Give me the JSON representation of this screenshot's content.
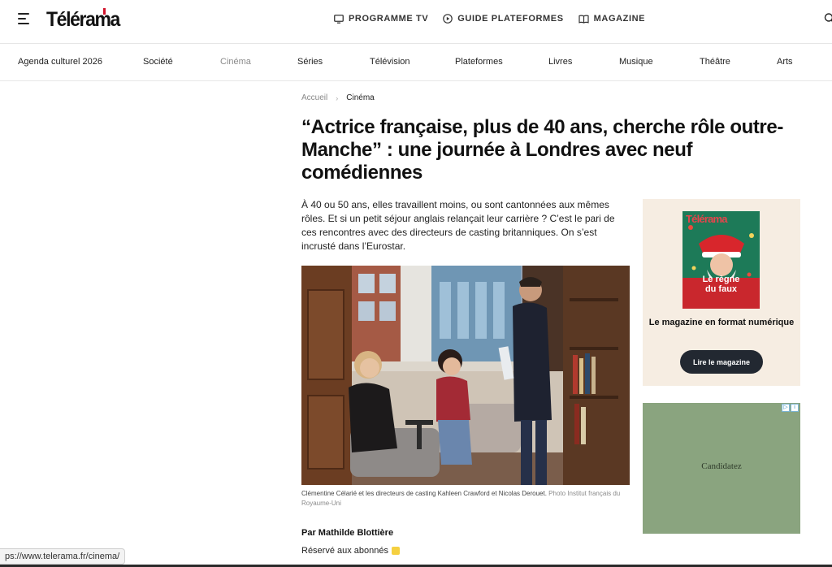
{
  "header": {
    "logo": "Télérama",
    "nav": [
      {
        "label": "PROGRAMME TV",
        "icon": "tv-icon"
      },
      {
        "label": "GUIDE PLATEFORMES",
        "icon": "play-icon"
      },
      {
        "label": "MAGAZINE",
        "icon": "book-icon"
      }
    ],
    "search_icon": "search-icon",
    "menu_icon": "hamburger-icon"
  },
  "sections": [
    "Agenda culturel 2026",
    "Société",
    "Cinéma",
    "Séries",
    "Télévision",
    "Plateformes",
    "Livres",
    "Musique",
    "Théâtre",
    "Arts"
  ],
  "active_section": "Cinéma",
  "breadcrumb": {
    "home": "Accueil",
    "current": "Cinéma"
  },
  "article": {
    "title": "“Actrice française, plus de 40 ans, cherche rôle outre-Manche” : une journée à Londres avec neuf comédiennes",
    "chapo": "À 40 ou 50 ans, elles travaillent moins, ou sont cantonnées aux mêmes rôles. Et si un petit séjour anglais relançait leur carrière ? C’est le pari de ces rencontres avec des directeurs de casting britanniques. On s’est incrusté dans l’Eurostar.",
    "caption": "Clémentine Célarié et les directeurs de casting Kahleen Crawford et Nicolas Derouet.",
    "credit": "Photo Institut français du Royaume-Uni",
    "author": "Par Mathilde Blottière",
    "access": "Réservé aux abonnés"
  },
  "sidebar": {
    "magazine_brand": "Télérama",
    "cover_headline_1": "Le règne",
    "cover_headline_2": "du faux",
    "magazine_text": "Le magazine en format numérique",
    "magazine_button": "Lire le magazine",
    "ad_text": "Candidatez"
  },
  "status_url": "ps://www.telerama.fr/cinema/",
  "colors": {
    "accent": "#d2142c",
    "button": "#222831",
    "card_bg": "#f6ede2",
    "ad_bg": "#8aa47f"
  }
}
